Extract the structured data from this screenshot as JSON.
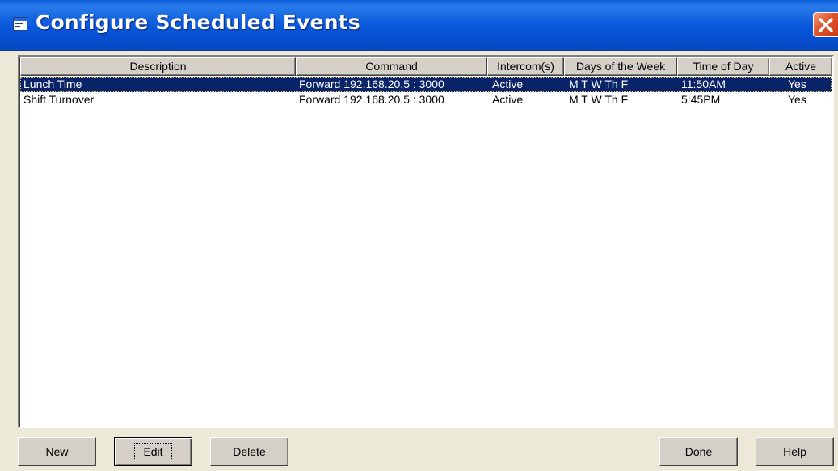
{
  "window": {
    "title": "Configure Scheduled Events",
    "icon": "window-icon",
    "close_icon": "close-icon",
    "title_bar_color": "#0A5CD8",
    "close_button_color": "#E2542C"
  },
  "list": {
    "columns": [
      {
        "label": "Description"
      },
      {
        "label": "Command"
      },
      {
        "label": "Intercom(s)"
      },
      {
        "label": "Days of the Week"
      },
      {
        "label": "Time of Day"
      },
      {
        "label": "Active"
      }
    ],
    "rows": [
      {
        "selected": true,
        "description": "Lunch Time",
        "command": "Forward 192.168.20.5 : 3000",
        "intercoms": "Active",
        "days": "M T W Th F",
        "time": "11:50AM",
        "active": "Yes"
      },
      {
        "selected": false,
        "description": "Shift Turnover",
        "command": "Forward 192.168.20.5 : 3000",
        "intercoms": "Active",
        "days": "M T W Th F",
        "time": "5:45PM",
        "active": "Yes"
      }
    ],
    "selection_color": "#0A246A"
  },
  "buttons": {
    "new": "New",
    "edit": "Edit",
    "delete": "Delete",
    "done": "Done",
    "help": "Help"
  }
}
